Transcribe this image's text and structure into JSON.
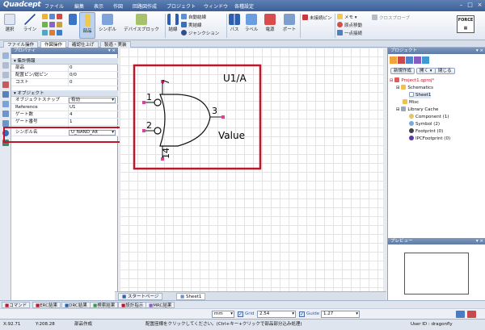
{
  "app": {
    "name": "Quadcept"
  },
  "menu": [
    "ファイル",
    "編集",
    "表示",
    "作図",
    "回路図作成",
    "プロジェクト",
    "ウィンドウ",
    "各種設定"
  ],
  "ribbon": {
    "select": "選択",
    "line": "ライン",
    "part": "部品",
    "symbol": "シンボル",
    "device_block": "デバイスブロック",
    "wire": "結線",
    "auto_wire": "自動結線",
    "real_wire": "実結線",
    "junction": "ジャンクション",
    "bus": "バス",
    "label": "ラベル",
    "power": "電源",
    "port": "ポート",
    "unconnected_pin": "未接続ピン",
    "memo": "メモ",
    "origin_move": "原点移動",
    "single_point": "一点接続",
    "cross_probe": "クロスプローブ"
  },
  "ribbon_tabs": [
    "ファイル操作",
    "作図操作",
    "確認仕上げ",
    "製造・実装"
  ],
  "properties": {
    "title": "プロパティ",
    "section_stats": "集計情報",
    "rows_stats": [
      {
        "key": "部品",
        "value": "0"
      },
      {
        "key": "配置ピン/総ピン",
        "value": "0/0"
      },
      {
        "key": "コスト",
        "value": "0"
      }
    ],
    "section_object": "オブジェクト",
    "snap_label": "オブジェクトスナップ",
    "snap_value": "有効",
    "rows_object": [
      {
        "key": "Reference",
        "value": "U1"
      },
      {
        "key": "ゲート数",
        "value": "4"
      },
      {
        "key": "ゲート番号",
        "value": "1"
      }
    ],
    "symbol_name_label": "シンボル名",
    "symbol_name_value": "U_NAND_Alt"
  },
  "symbol": {
    "reference": "U1/A",
    "value": "Value",
    "pins": {
      "top": "7",
      "in1": "1",
      "in2": "2",
      "out": "3",
      "bottom": "14"
    }
  },
  "doc_tabs": [
    "スタートページ",
    "Sheet1"
  ],
  "project": {
    "title": "プロジェクト",
    "btn_new": "新規作成",
    "btn_open": "開く",
    "btn_close": "閉じる",
    "tree": [
      "Project1.qproj*",
      "Schematics",
      "Sheet1",
      "Misc",
      "Library Cache",
      "Component (1)",
      "Symbol (2)",
      "Footprint (0)",
      "IPCFootprint (0)"
    ]
  },
  "preview": {
    "title": "プレビュー"
  },
  "output_tabs": [
    "コマンド",
    "ERC結果",
    "DRC結果",
    "検索結果",
    "設計指示",
    "MRC結果"
  ],
  "options": {
    "unit": "mm",
    "grid_label": "Grid",
    "grid_value": "2.54",
    "guide_label": "Guide",
    "guide_value": "1.27"
  },
  "status": {
    "x": "X:92.71",
    "y": "Y:208.28",
    "mode": "部品作成",
    "hint": "配置座標をクリックしてください。(Ctrl+キー+クリックで部品部分込み処理)",
    "user": "User ID : dragonfly"
  },
  "colors": {
    "highlight": "#c0162c",
    "accent": "#3c5f98",
    "pin": "#e0409a"
  }
}
